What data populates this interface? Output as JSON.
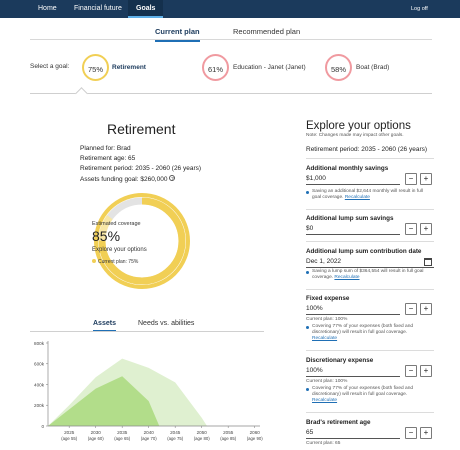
{
  "nav": {
    "items": [
      {
        "label": "Home",
        "active": false
      },
      {
        "label": "Financial future",
        "active": false
      },
      {
        "label": "Goals",
        "active": true
      }
    ],
    "logoff_label": "Log off"
  },
  "plan_tabs": [
    {
      "label": "Current plan",
      "active": true
    },
    {
      "label": "Recommended plan",
      "active": false
    }
  ],
  "goals": {
    "select_label": "Select a goal:",
    "items": [
      {
        "percent": "75%",
        "name": "Retirement",
        "selected": true,
        "ring_color": "#f1cf55"
      },
      {
        "percent": "61%",
        "name": "Education - Janet (Janet)",
        "selected": false,
        "ring_color": "#f09aa0"
      },
      {
        "percent": "58%",
        "name": "Boat (Brad)",
        "selected": false,
        "ring_color": "#f09aa0"
      }
    ]
  },
  "retirement": {
    "title": "Retirement",
    "planned_for": "Planned for:  Brad",
    "retirement_age": "Retirement age:  65",
    "retirement_period": "Retirement period:  2035 - 2060 (26 years)",
    "assets_funding_goal": "Assets funding goal:  $260,000"
  },
  "donut": {
    "estimated_label": "Estimated coverage",
    "percent_text": "85%",
    "explore_label": "Explore your options",
    "current_plan_label": "Current plan: 75%",
    "estimated_value": 85,
    "current_value": 75,
    "colors": {
      "outer": "#f1cf55",
      "inner_track": "#e3e3e3",
      "inner_fill": "#f8e7a6"
    }
  },
  "chart_tabs": [
    {
      "label": "Assets",
      "active": true
    },
    {
      "label": "Needs vs. abilities",
      "active": false
    }
  ],
  "chart_data": {
    "type": "area",
    "title": "",
    "xlabel": "",
    "ylabel": "",
    "ylim": [
      0,
      800000
    ],
    "y_ticks": [
      "800k",
      "600k",
      "400k",
      "200k",
      "0"
    ],
    "x": [
      2025,
      2030,
      2035,
      2040,
      2045,
      2050,
      2055,
      2060
    ],
    "x_tick_labels": [
      [
        "2025",
        "(age 55)"
      ],
      [
        "2030",
        "(age 60)"
      ],
      [
        "2035",
        "(age 65)"
      ],
      [
        "2040",
        "(age 70)"
      ],
      [
        "2045",
        "(age 75)"
      ],
      [
        "2050",
        "(age 80)"
      ],
      [
        "2055",
        "(age 85)"
      ],
      [
        "2060",
        "(age 90)"
      ]
    ],
    "series": [
      {
        "color": "#dff0d0",
        "points": [
          [
            2021,
            0
          ],
          [
            2025,
            200000
          ],
          [
            2030,
            470000
          ],
          [
            2035,
            650000
          ],
          [
            2040,
            560000
          ],
          [
            2045,
            420000
          ],
          [
            2050,
            80000
          ],
          [
            2051,
            0
          ]
        ]
      },
      {
        "color": "#b2dd8a",
        "points": [
          [
            2021,
            0
          ],
          [
            2025,
            160000
          ],
          [
            2030,
            360000
          ],
          [
            2035,
            480000
          ],
          [
            2040,
            240000
          ],
          [
            2042,
            0
          ]
        ]
      }
    ],
    "grid": false
  },
  "explore": {
    "title": "Explore your options",
    "note": "Note: Changes made may impact other goals.",
    "retirement_period": "Retirement period:  2035 - 2060 (26 years)",
    "monthly_savings": {
      "label": "Additional monthly savings",
      "value": "$1,000",
      "hint": "Saving an additional $2,644 monthly will result in full goal coverage.",
      "link": "Recalculate"
    },
    "lump_sum": {
      "label": "Additional lump sum savings",
      "value": "$0"
    },
    "lump_date": {
      "label": "Additional lump sum contribution date",
      "value": "Dec 1, 2022",
      "hint": "Saving a lump sum of $364,554 will result in full goal coverage.",
      "link": "Recalculate"
    },
    "fixed_expense": {
      "label": "Fixed expense",
      "value": "100%",
      "sub": "Current plan: 100%",
      "hint": "Covering 77% of your expenses (both fixed and discretionary) will result in full goal coverage.",
      "link": "Recalculate"
    },
    "discretionary_expense": {
      "label": "Discretionary expense",
      "value": "100%",
      "sub": "Current plan: 100%",
      "hint": "Covering 77% of your expenses (both fixed and discretionary) will result in full goal coverage.",
      "link": "Recalculate"
    },
    "brad_retirement_age": {
      "label": "Brad's retirement age",
      "value": "65",
      "sub": "Current plan: 65"
    },
    "minus_symbol": "−",
    "plus_symbol": "+"
  }
}
